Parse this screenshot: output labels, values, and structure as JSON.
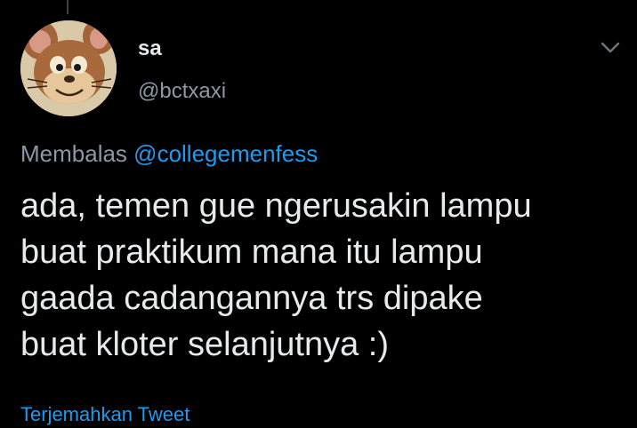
{
  "tweet": {
    "display_name": "sa",
    "handle": "@bctxaxi",
    "reply_prefix": "Membalas",
    "reply_mention": "@collegemenfess",
    "text": "ada, temen gue ngerusakin lampu\nbuat praktikum mana itu lampu\ngaada cadangannya trs dipake\nbuat kloter selanjutnya :)",
    "translate_label": "Terjemahkan Tweet"
  },
  "icons": {
    "more": "chevron-down-icon",
    "avatar": "cartoon-mouse-avatar"
  },
  "colors": {
    "background": "#000000",
    "primary_text": "#e7e9ea",
    "secondary_text": "#8b98a5",
    "link": "#1d9bf0"
  }
}
